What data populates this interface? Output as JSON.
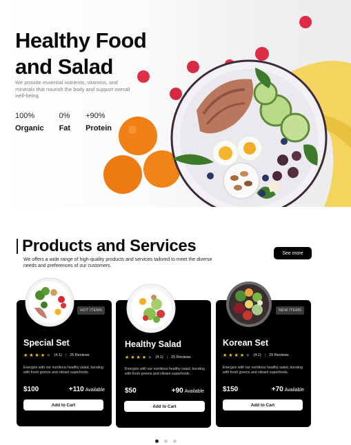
{
  "hero": {
    "title_line1": "Healthy Food",
    "title_line2": "and Salad",
    "description": "We provide essential nutrients, vitamins, and minerals that nourish the body and support overall well-being.",
    "stats": [
      {
        "value": "100%",
        "label": "Organic"
      },
      {
        "value": "0%",
        "label": "Fat"
      },
      {
        "value": "+90%",
        "label": "Protein"
      }
    ]
  },
  "products": {
    "title": "Products and Services",
    "description": "We offers a wide range of high-quality products and services tailored to meet the diverse needs and preferences of our customers.",
    "see_more": "See more",
    "cards": [
      {
        "badge": "HOT ITEMS",
        "name": "Special Set",
        "rating": "(4.1)",
        "stars": 4,
        "reviews": "25 Reviews",
        "description": "Energize with our nutritious healthy salad, bursting with fresh greens and vibrant superfoods.",
        "price": "$100",
        "available_count": "+110",
        "available_label": "Available",
        "button": "Add to Cart"
      },
      {
        "badge": "",
        "name": "Healthy Salad",
        "rating": "(4.1)",
        "stars": 4,
        "reviews": "25 Reviews",
        "description": "Energize with our nutritious healthy salad, bursting with fresh greens and vibrant superfoods.",
        "price": "$50",
        "available_count": "+90",
        "available_label": "Available",
        "button": "Add to Cart"
      },
      {
        "badge": "NEW ITEMS",
        "name": "Korean Set",
        "rating": "(4.1)",
        "stars": 4,
        "reviews": "25 Reviews",
        "description": "Energize with our nutritious healthy salad, bursting with fresh greens and vibrant superfoods.",
        "price": "$150",
        "available_count": "+70",
        "available_label": "Available",
        "button": "Add to Cart"
      }
    ]
  },
  "pagination": {
    "total": 3,
    "active": 1
  },
  "colors": {
    "accent": "#000000",
    "star": "#f5c518",
    "badge": "#3a3a3a"
  }
}
